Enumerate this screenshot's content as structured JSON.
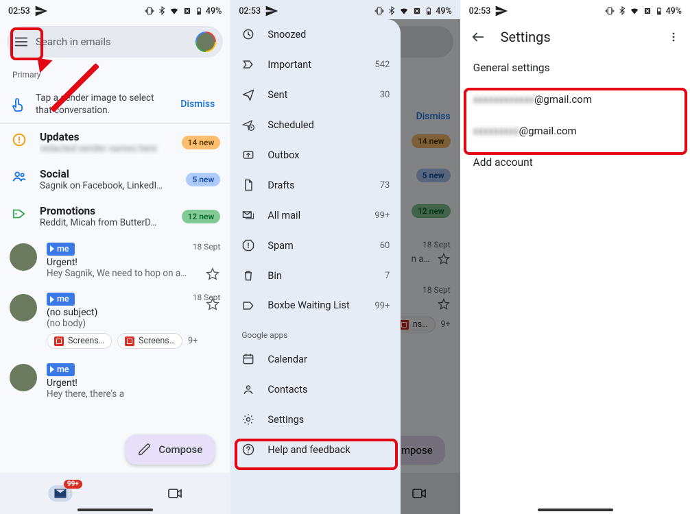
{
  "status": {
    "time": "02:53",
    "battery": "49%"
  },
  "p1": {
    "search_placeholder": "Search in emails",
    "primary_label": "Primary",
    "hint_text": "Tap a sender image to select that conversation.",
    "dismiss": "Dismiss",
    "cat_updates": {
      "title": "Updates",
      "sub": "redacted sender names here",
      "badge": "14 new"
    },
    "cat_social": {
      "title": "Social",
      "sub": "Sagnik on Facebook, LinkedI…",
      "badge": "5 new"
    },
    "cat_promos": {
      "title": "Promotions",
      "sub": "Reddit, Micah from ButterD…",
      "badge": "12 new"
    },
    "m1": {
      "sender": "me",
      "date": "18 Sept",
      "subj": "Urgent!",
      "body": "Hey Sagnik, We need to hop on a…"
    },
    "m2": {
      "sender": "me",
      "date": "18 Sept",
      "subj": "(no subject)",
      "body": "(no body)",
      "att1": "Screens…",
      "att2": "Screens…",
      "more": "9+"
    },
    "m3": {
      "sender": "me",
      "subj": "Urgent!",
      "body": "Hey there, there's a"
    },
    "compose": "Compose",
    "mailcount": "99+"
  },
  "p2": {
    "items": [
      {
        "label": "Snoozed",
        "cnt": ""
      },
      {
        "label": "Important",
        "cnt": "542"
      },
      {
        "label": "Sent",
        "cnt": "30"
      },
      {
        "label": "Scheduled",
        "cnt": ""
      },
      {
        "label": "Outbox",
        "cnt": ""
      },
      {
        "label": "Drafts",
        "cnt": "73"
      },
      {
        "label": "All mail",
        "cnt": "99+"
      },
      {
        "label": "Spam",
        "cnt": "60"
      },
      {
        "label": "Bin",
        "cnt": "7"
      },
      {
        "label": "Boxbe Waiting List",
        "cnt": "99+"
      }
    ],
    "section_apps": "Google apps",
    "app1": "Calendar",
    "app2": "Contacts",
    "settings": "Settings",
    "help": "Help and feedback"
  },
  "p3": {
    "title": "Settings",
    "general": "General settings",
    "acct_suffix": "@gmail.com",
    "add": "Add account"
  }
}
